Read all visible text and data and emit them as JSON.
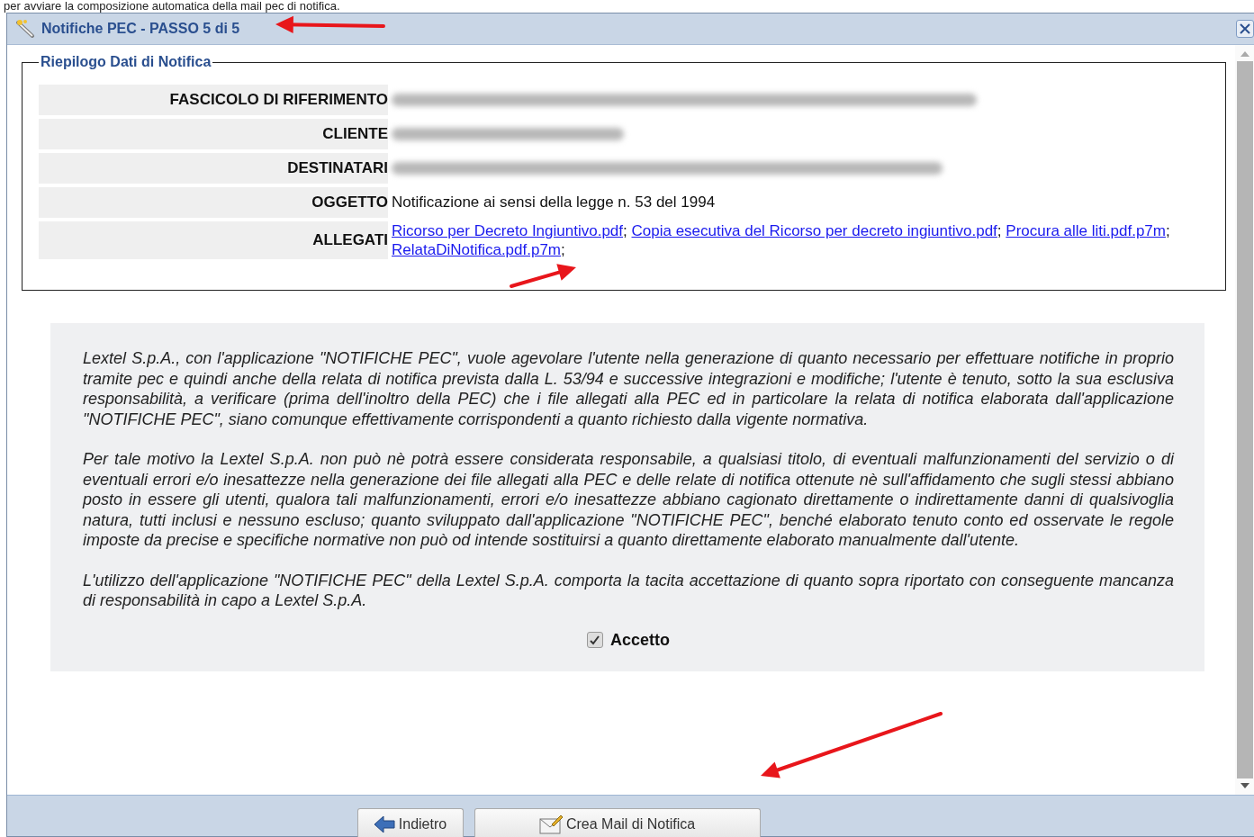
{
  "intro_text": "per avviare la composizione automatica della mail pec di notifica.",
  "dialog": {
    "title": "Notifiche PEC - PASSO 5 di 5"
  },
  "summary": {
    "legend": "Riepilogo Dati di Notifica",
    "rows": [
      {
        "label": "FASCICOLO DI RIFERIMENTO",
        "kind": "blurred"
      },
      {
        "label": "CLIENTE",
        "kind": "blurred"
      },
      {
        "label": "DESTINATARI",
        "kind": "blurred"
      },
      {
        "label": "OGGETTO",
        "kind": "text",
        "value": "Notificazione ai sensi della legge n. 53 del 1994"
      },
      {
        "label": "ALLEGATI",
        "kind": "links",
        "separator": ";",
        "links": [
          "Ricorso per Decreto Ingiuntivo.pdf",
          "Copia esecutiva del Ricorso per decreto ingiuntivo.pdf",
          "Procura alle liti.pdf.p7m",
          "RelataDiNotifica.pdf.p7m"
        ]
      }
    ]
  },
  "disclaimer": {
    "paragraphs": [
      "Lextel S.p.A., con l'applicazione \"NOTIFICHE PEC\", vuole agevolare l'utente nella generazione di quanto necessario per effettuare notifiche in proprio tramite pec e quindi anche della relata di notifica prevista dalla L. 53/94 e successive integrazioni e modifiche; l'utente è tenuto, sotto la sua esclusiva responsabilità, a verificare (prima dell'inoltro della PEC) che i file allegati alla PEC ed in particolare la relata di notifica elaborata dall'applicazione \"NOTIFICHE PEC\", siano comunque effettivamente corrispondenti a quanto richiesto dalla vigente normativa.",
      "Per tale motivo la Lextel S.p.A. non può nè potrà essere considerata responsabile, a qualsiasi titolo, di eventuali malfunzionamenti del servizio o di eventuali errori e/o inesattezze nella generazione dei file allegati alla PEC e delle relate di notifica ottenute nè sull'affidamento che sugli stessi abbiano posto in essere gli utenti, qualora tali malfunzionamenti, errori e/o inesattezze abbiano cagionato direttamente o indirettamente danni di qualsivoglia natura, tutti inclusi e nessuno escluso; quanto sviluppato dall'applicazione \"NOTIFICHE PEC\", benché elaborato tenuto conto ed osservate le regole imposte da precise e specifiche normative non può od intende sostituirsi a quanto direttamente elaborato manualmente dall'utente.",
      "L'utilizzo dell'applicazione \"NOTIFICHE PEC\" della Lextel S.p.A. comporta la tacita accettazione di quanto sopra riportato con conseguente mancanza di responsabilità in capo a Lextel S.p.A."
    ],
    "accept": {
      "label": "Accetto",
      "checked": true
    }
  },
  "buttons": [
    {
      "label": "Indietro",
      "kind": "back"
    },
    {
      "label": "Crea Mail di Notifica",
      "kind": "mail"
    }
  ]
}
